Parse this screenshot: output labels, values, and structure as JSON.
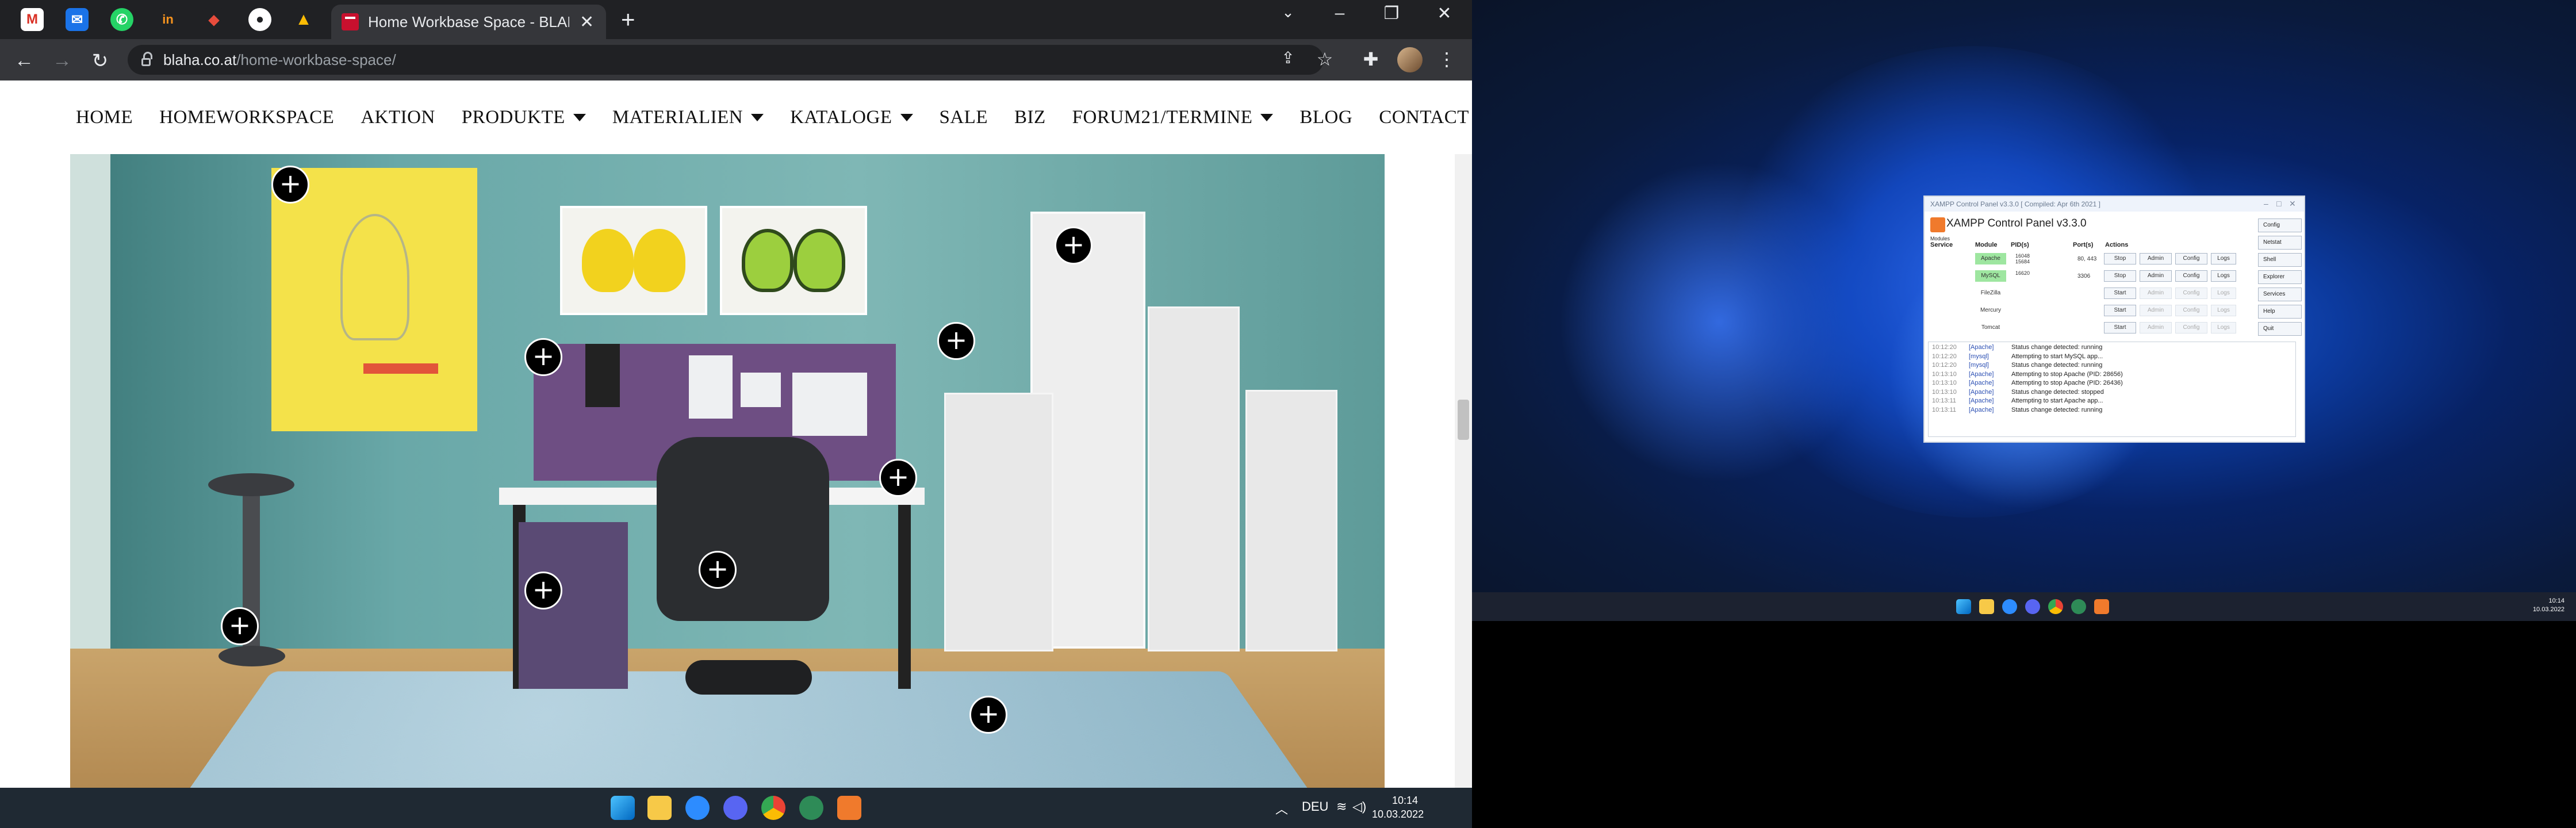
{
  "browser": {
    "tab_title": "Home Workbase Space - BLAHA",
    "url_host": "blaha.co.at",
    "url_path": "/home-workbase-space/"
  },
  "site": {
    "nav": [
      {
        "label": "HOME"
      },
      {
        "label": "HOMEWORKSPACE"
      },
      {
        "label": "AKTION"
      },
      {
        "label": "PRODUKTE",
        "dropdown": true
      },
      {
        "label": "MATERIALIEN",
        "dropdown": true
      },
      {
        "label": "KATALOGE",
        "dropdown": true
      },
      {
        "label": "SALE"
      },
      {
        "label": "BIZ"
      },
      {
        "label": "FORUM21/TERMINE",
        "dropdown": true
      },
      {
        "label": "BLOG"
      },
      {
        "label": "CONTACT"
      }
    ],
    "hotspot_symbol": "+"
  },
  "taskbar1": {
    "tray_lang": "DEU",
    "time": "10:14",
    "date": "10.03.2022"
  },
  "taskbar2": {
    "time": "10:14",
    "date": "10.03.2022"
  },
  "xampp": {
    "title": "XAMPP Control Panel v3.3.0   [ Compiled: Apr 6th 2021 ]",
    "heading": "XAMPP Control Panel v3.3.0",
    "col_modules": "Modules",
    "col_service": "Service",
    "col_module": "Module",
    "col_pids": "PID(s)",
    "col_ports": "Port(s)",
    "col_actions": "Actions",
    "side_buttons": [
      "Config",
      "Netstat",
      "Shell",
      "Explorer",
      "Services",
      "Help",
      "Quit"
    ],
    "modules": [
      {
        "name": "Apache",
        "pid": "16048\n15684",
        "ports": "80, 443",
        "action": "Stop",
        "running": true
      },
      {
        "name": "MySQL",
        "pid": "16620",
        "ports": "3306",
        "action": "Stop",
        "running": true
      },
      {
        "name": "FileZilla",
        "pid": "",
        "ports": "",
        "action": "Start",
        "running": false
      },
      {
        "name": "Mercury",
        "pid": "",
        "ports": "",
        "action": "Start",
        "running": false
      },
      {
        "name": "Tomcat",
        "pid": "",
        "ports": "",
        "action": "Start",
        "running": false
      }
    ],
    "btn_admin": "Admin",
    "btn_config": "Config",
    "btn_logs": "Logs",
    "log": [
      {
        "time": "10:12:20",
        "module": "[Apache]",
        "msg": "Status change detected: running"
      },
      {
        "time": "10:12:20",
        "module": "[mysql]",
        "msg": "Attempting to start MySQL app..."
      },
      {
        "time": "10:12:20",
        "module": "[mysql]",
        "msg": "Status change detected: running"
      },
      {
        "time": "10:13:10",
        "module": "[Apache]",
        "msg": "Attempting to stop Apache (PID: 28656)"
      },
      {
        "time": "10:13:10",
        "module": "[Apache]",
        "msg": "Attempting to stop Apache (PID: 26436)"
      },
      {
        "time": "10:13:10",
        "module": "[Apache]",
        "msg": "Status change detected: stopped"
      },
      {
        "time": "10:13:11",
        "module": "[Apache]",
        "msg": "Attempting to start Apache app..."
      },
      {
        "time": "10:13:11",
        "module": "[Apache]",
        "msg": "Status change detected: running"
      }
    ]
  }
}
